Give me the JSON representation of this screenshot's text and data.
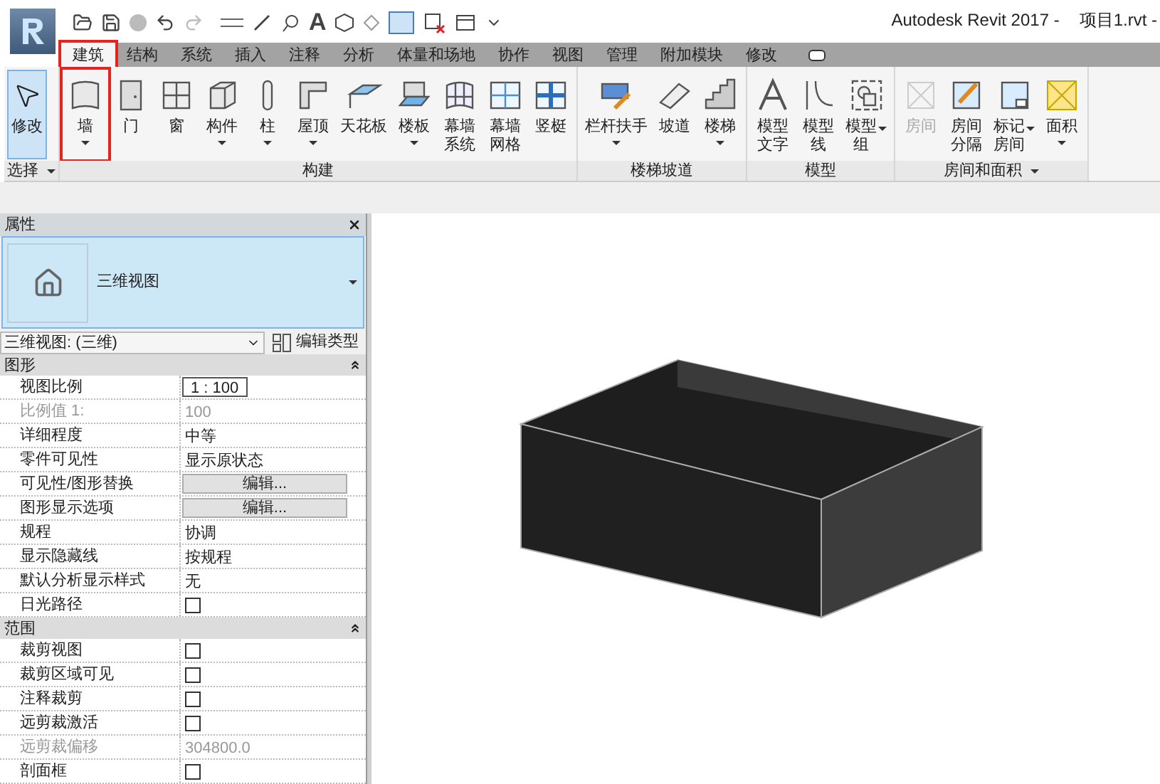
{
  "window": {
    "title": "Autodesk Revit 2017 -",
    "file": "项目1.rvt -"
  },
  "quick_access": {
    "text_tool": "A"
  },
  "tabs": [
    {
      "label": "建筑",
      "selected": true,
      "annotated": true
    },
    {
      "label": "结构",
      "selected": false,
      "annotated": false
    },
    {
      "label": "系统",
      "selected": false,
      "annotated": false
    },
    {
      "label": "插入",
      "selected": false,
      "annotated": false
    },
    {
      "label": "注释",
      "selected": false,
      "annotated": false
    },
    {
      "label": "分析",
      "selected": false,
      "annotated": false
    },
    {
      "label": "体量和场地",
      "selected": false,
      "annotated": false
    },
    {
      "label": "协作",
      "selected": false,
      "annotated": false
    },
    {
      "label": "视图",
      "selected": false,
      "annotated": false
    },
    {
      "label": "管理",
      "selected": false,
      "annotated": false
    },
    {
      "label": "附加模块",
      "selected": false,
      "annotated": false
    },
    {
      "label": "修改",
      "selected": false,
      "annotated": false
    }
  ],
  "ribbon_panels": [
    {
      "label": "选择",
      "menu": true,
      "tools": [
        {
          "lines": [
            "修改"
          ],
          "kind": "plain",
          "disabled": false,
          "selected": true,
          "annotated": false
        }
      ]
    },
    {
      "label": "构建",
      "menu": false,
      "tools": [
        {
          "lines": [
            "墙"
          ],
          "kind": "menu",
          "disabled": false,
          "selected": false,
          "annotated": true
        },
        {
          "lines": [
            "门"
          ],
          "kind": "plain",
          "disabled": false,
          "selected": false,
          "annotated": false
        },
        {
          "lines": [
            "窗"
          ],
          "kind": "plain",
          "disabled": false,
          "selected": false,
          "annotated": false
        },
        {
          "lines": [
            "构件"
          ],
          "kind": "menu",
          "disabled": false,
          "selected": false,
          "annotated": false
        },
        {
          "lines": [
            "柱"
          ],
          "kind": "menu",
          "disabled": false,
          "selected": false,
          "annotated": false
        },
        {
          "lines": [
            "屋顶"
          ],
          "kind": "menu",
          "disabled": false,
          "selected": false,
          "annotated": false
        },
        {
          "lines": [
            "天花板"
          ],
          "kind": "plain",
          "disabled": false,
          "selected": false,
          "annotated": false
        },
        {
          "lines": [
            "楼板"
          ],
          "kind": "menu",
          "disabled": false,
          "selected": false,
          "annotated": false
        },
        {
          "lines": [
            "幕墙",
            "系统"
          ],
          "kind": "plain",
          "disabled": false,
          "selected": false,
          "annotated": false
        },
        {
          "lines": [
            "幕墙",
            "网格"
          ],
          "kind": "plain",
          "disabled": false,
          "selected": false,
          "annotated": false
        },
        {
          "lines": [
            "竖梃"
          ],
          "kind": "plain",
          "disabled": false,
          "selected": false,
          "annotated": false
        }
      ]
    },
    {
      "label": "楼梯坡道",
      "menu": false,
      "tools": [
        {
          "lines": [
            "栏杆扶手"
          ],
          "kind": "menu",
          "disabled": false,
          "selected": false,
          "annotated": false
        },
        {
          "lines": [
            "坡道"
          ],
          "kind": "plain",
          "disabled": false,
          "selected": false,
          "annotated": false
        },
        {
          "lines": [
            "楼梯"
          ],
          "kind": "menu",
          "disabled": false,
          "selected": false,
          "annotated": false
        }
      ]
    },
    {
      "label": "模型",
      "menu": false,
      "tools": [
        {
          "lines": [
            "模型",
            "文字"
          ],
          "kind": "plain",
          "disabled": false,
          "selected": false,
          "annotated": false
        },
        {
          "lines": [
            "模型",
            "线"
          ],
          "kind": "plain",
          "disabled": false,
          "selected": false,
          "annotated": false
        },
        {
          "lines": [
            "模型",
            "组"
          ],
          "kind": "sidemenu",
          "disabled": false,
          "selected": false,
          "annotated": false
        }
      ]
    },
    {
      "label": "房间和面积",
      "menu": true,
      "tools": [
        {
          "lines": [
            "房间"
          ],
          "kind": "plain",
          "disabled": true,
          "selected": false,
          "annotated": false
        },
        {
          "lines": [
            "房间",
            "分隔"
          ],
          "kind": "plain",
          "disabled": false,
          "selected": false,
          "annotated": false
        },
        {
          "lines": [
            "标记",
            "房间"
          ],
          "kind": "sidemenu",
          "disabled": false,
          "selected": false,
          "annotated": false
        },
        {
          "lines": [
            "面积"
          ],
          "kind": "menu",
          "disabled": false,
          "selected": false,
          "annotated": false
        }
      ]
    }
  ],
  "properties": {
    "title": "属性",
    "type_name": "三维视图",
    "instance": "三维视图: (三维)",
    "edit_type": "编辑类型",
    "groups": [
      {
        "label": "图形",
        "rows": [
          {
            "label": "视图比例",
            "kind": "input",
            "value": "1 : 100",
            "disabled": false
          },
          {
            "label": "比例值 1:",
            "kind": "text",
            "value": "100",
            "disabled": true
          },
          {
            "label": "详细程度",
            "kind": "text",
            "value": "中等",
            "disabled": false
          },
          {
            "label": "零件可见性",
            "kind": "text",
            "value": "显示原状态",
            "disabled": false
          },
          {
            "label": "可见性/图形替换",
            "kind": "button",
            "value": "编辑...",
            "disabled": false
          },
          {
            "label": "图形显示选项",
            "kind": "button",
            "value": "编辑...",
            "disabled": false
          },
          {
            "label": "规程",
            "kind": "text",
            "value": "协调",
            "disabled": false
          },
          {
            "label": "显示隐藏线",
            "kind": "text",
            "value": "按规程",
            "disabled": false
          },
          {
            "label": "默认分析显示样式",
            "kind": "text",
            "value": "无",
            "disabled": false
          },
          {
            "label": "日光路径",
            "kind": "checkbox",
            "checked": false,
            "disabled": false
          }
        ]
      },
      {
        "label": "范围",
        "rows": [
          {
            "label": "裁剪视图",
            "kind": "checkbox",
            "checked": false,
            "disabled": false
          },
          {
            "label": "裁剪区域可见",
            "kind": "checkbox",
            "checked": false,
            "disabled": false
          },
          {
            "label": "注释裁剪",
            "kind": "checkbox",
            "checked": false,
            "disabled": false
          },
          {
            "label": "远剪裁激活",
            "kind": "checkbox",
            "checked": false,
            "disabled": false
          },
          {
            "label": "远剪裁偏移",
            "kind": "text",
            "value": "304800.0",
            "disabled": true
          },
          {
            "label": "剖面框",
            "kind": "checkbox",
            "checked": false,
            "disabled": false
          }
        ]
      }
    ]
  }
}
